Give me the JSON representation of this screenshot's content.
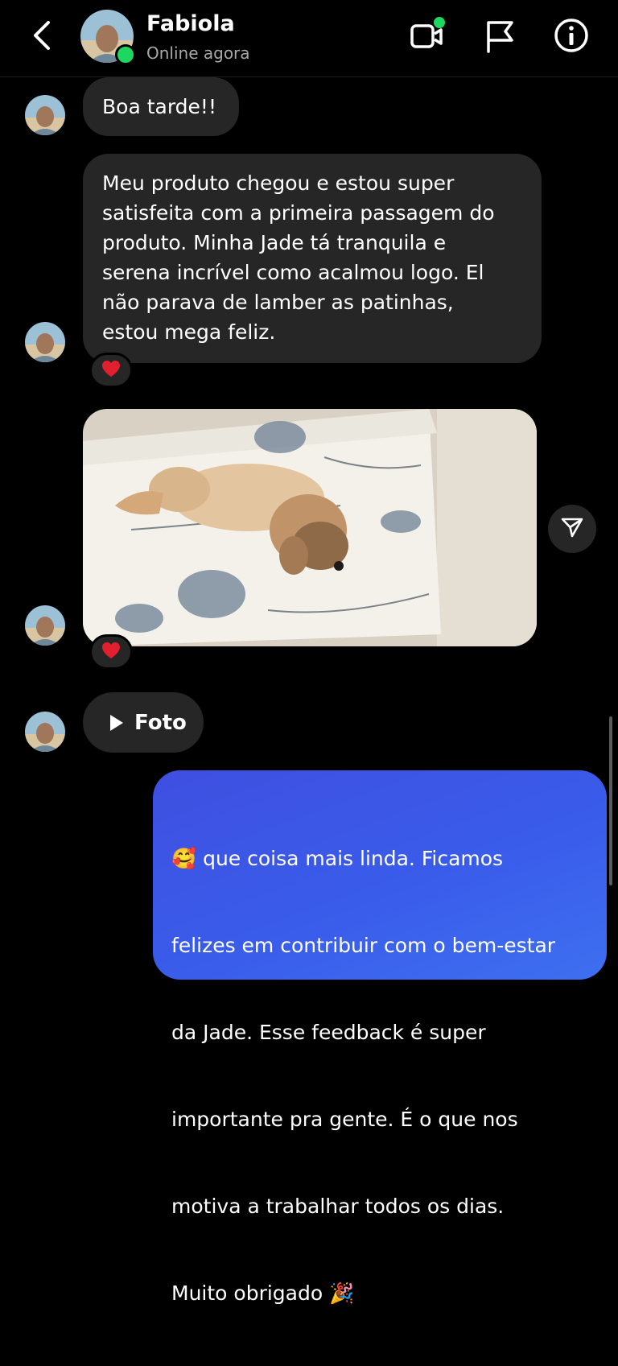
{
  "header": {
    "contact_name": "Fabiola",
    "status": "Online agora"
  },
  "messages": [
    {
      "from": "contact",
      "type": "text",
      "text": "Boa tarde!!"
    },
    {
      "from": "contact",
      "type": "text",
      "text": "Meu produto chegou e estou super satisfeita com a primeira passagem do produto. Minha Jade tá tranquila e serena incrível como acalmou logo. El não parava de lamber as patinhas, estou mega feliz.",
      "reaction": "❤️"
    },
    {
      "from": "contact",
      "type": "photo",
      "reaction": "❤️"
    },
    {
      "from": "contact",
      "type": "video",
      "label": "Foto"
    },
    {
      "from": "me",
      "type": "text",
      "emoji_start": "🥰",
      "text": " que coisa mais linda. Ficamos felizes em contribuir com o bem-estar da Jade. Esse feedback é super importante pra gente. É o que nos motiva a trabalhar todos os dias. Muito obrigado ",
      "emoji_end": "🎉"
    }
  ],
  "bubble_lines": [
    "Meu produto chegou e estou super",
    "satisfeita com a primeira passagem do",
    "produto. Minha Jade tá tranquila e",
    "serena incrível como acalmou logo. El",
    "não parava de lamber as patinhas,",
    "estou mega feliz."
  ],
  "sent_lines": [
    " que coisa mais linda. Ficamos",
    "felizes em contribuir com o bem-estar",
    "da Jade. Esse feedback é super",
    "importante pra gente. É o que nos",
    "motiva a trabalhar todos os dias.",
    "Muito obrigado "
  ],
  "colors": {
    "background": "#000000",
    "received_bubble": "#262626",
    "sent_bubble": "#3a5cea",
    "online": "#1ed760",
    "secondary_text": "#a8a8a8"
  },
  "icons": [
    "chevron-left-icon",
    "video-call-icon",
    "flag-icon",
    "info-icon",
    "send-icon",
    "play-icon",
    "heart-icon"
  ]
}
